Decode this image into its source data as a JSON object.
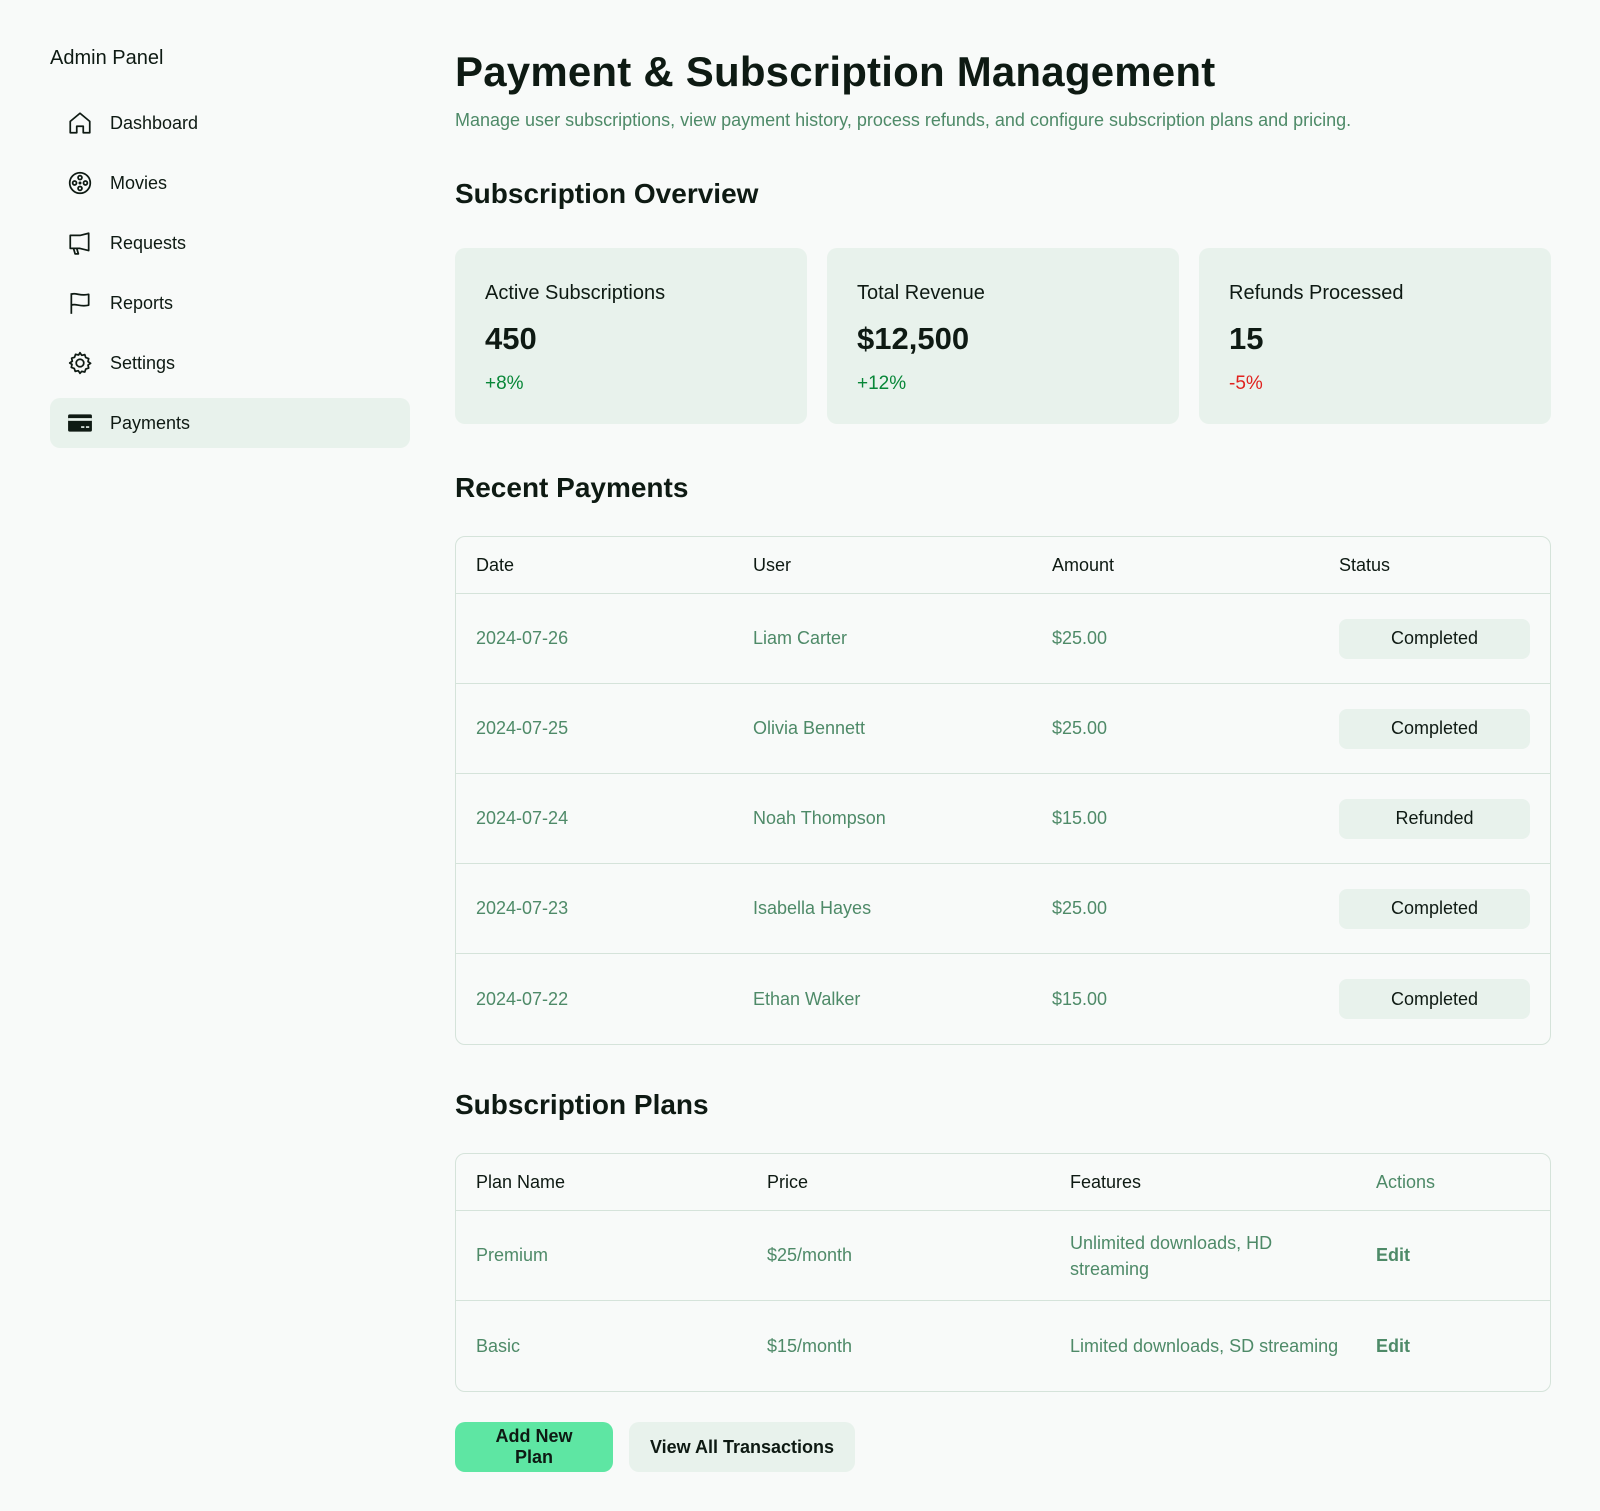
{
  "sidebar": {
    "title": "Admin Panel",
    "items": [
      {
        "label": "Dashboard",
        "icon": "house-icon"
      },
      {
        "label": "Movies",
        "icon": "film-reel-icon"
      },
      {
        "label": "Requests",
        "icon": "megaphone-icon"
      },
      {
        "label": "Reports",
        "icon": "flag-icon"
      },
      {
        "label": "Settings",
        "icon": "gear-icon"
      },
      {
        "label": "Payments",
        "icon": "credit-card-icon",
        "active": true
      }
    ]
  },
  "header": {
    "title": "Payment & Subscription Management",
    "subtitle": "Manage user subscriptions, view payment history, process refunds, and configure subscription plans and pricing."
  },
  "overview": {
    "title": "Subscription Overview",
    "cards": [
      {
        "label": "Active Subscriptions",
        "value": "450",
        "change": "+8%"
      },
      {
        "label": "Total Revenue",
        "value": "$12,500",
        "change": "+12%"
      },
      {
        "label": "Refunds Processed",
        "value": "15",
        "change": "-5%"
      }
    ]
  },
  "payments": {
    "title": "Recent Payments",
    "columns": [
      "Date",
      "User",
      "Amount",
      "Status"
    ],
    "rows": [
      {
        "date": "2024-07-26",
        "user": "Liam Carter",
        "amount": "$25.00",
        "status": "Completed"
      },
      {
        "date": "2024-07-25",
        "user": "Olivia Bennett",
        "amount": "$25.00",
        "status": "Completed"
      },
      {
        "date": "2024-07-24",
        "user": "Noah Thompson",
        "amount": "$15.00",
        "status": "Refunded"
      },
      {
        "date": "2024-07-23",
        "user": "Isabella Hayes",
        "amount": "$25.00",
        "status": "Completed"
      },
      {
        "date": "2024-07-22",
        "user": "Ethan Walker",
        "amount": "$15.00",
        "status": "Completed"
      }
    ]
  },
  "plans": {
    "title": "Subscription Plans",
    "columns": [
      "Plan Name",
      "Price",
      "Features",
      "Actions"
    ],
    "rows": [
      {
        "name": "Premium",
        "price": "$25/month",
        "features": "Unlimited downloads, HD streaming",
        "action": "Edit"
      },
      {
        "name": "Basic",
        "price": "$15/month",
        "features": "Limited downloads, SD streaming",
        "action": "Edit"
      }
    ]
  },
  "buttons": {
    "add_plan": "Add New Plan",
    "view_transactions": "View All Transactions"
  },
  "colors": {
    "accent_green": "#5ee6a3",
    "muted_green_text": "#4e8a68",
    "positive": "#088738",
    "negative": "#e0221e",
    "card_bg": "#e8f2ec"
  }
}
